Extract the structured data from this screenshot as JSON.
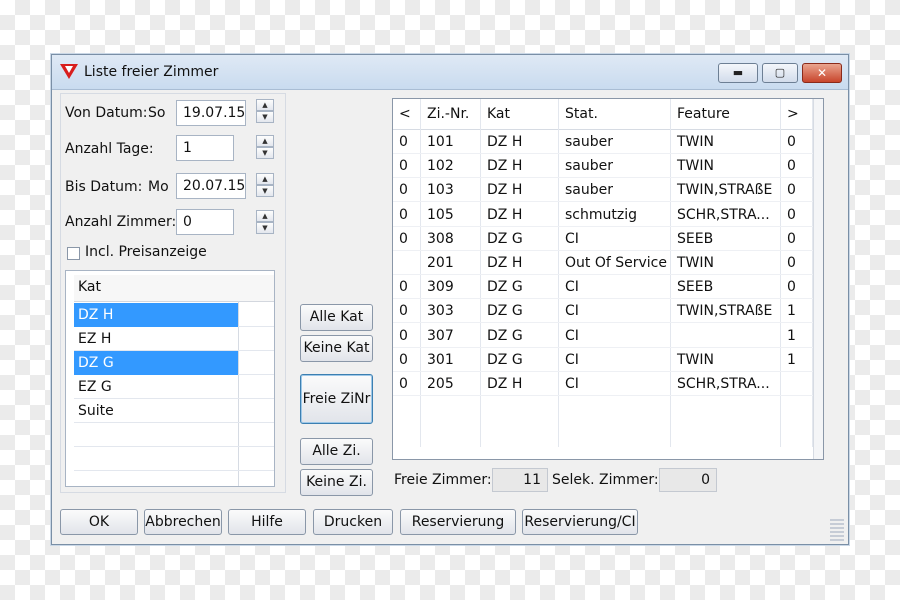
{
  "window": {
    "title": "Liste freier Zimmer",
    "minimize": "▬",
    "maximize": "▢",
    "close": "✕"
  },
  "form": {
    "von_datum_label": "Von Datum:",
    "von_day": "So",
    "von_value": "19.07.15",
    "anzahl_tage_label": "Anzahl Tage:",
    "anzahl_tage_value": "1",
    "bis_datum_label": "Bis Datum:",
    "bis_day": "Mo",
    "bis_value": "20.07.15",
    "anzahl_zimmer_label": "Anzahl Zimmer:",
    "anzahl_zimmer_value": "0",
    "preis_label": "Incl. Preisanzeige"
  },
  "kat_list": {
    "header": "Kat",
    "items": [
      {
        "label": "DZ H",
        "selected": true
      },
      {
        "label": "EZ H",
        "selected": false
      },
      {
        "label": "DZ G",
        "selected": true
      },
      {
        "label": "EZ G",
        "selected": false
      },
      {
        "label": "Suite",
        "selected": false
      }
    ]
  },
  "middle_buttons": {
    "alle_kat": "Alle Kat",
    "keine_kat": "Keine Kat",
    "freie_zinr": "Freie ZiNr",
    "alle_zi": "Alle Zi.",
    "keine_zi": "Keine Zi."
  },
  "grid": {
    "headers": [
      "<",
      "Zi.-Nr.",
      "Kat",
      "Stat.",
      "Feature",
      ">"
    ],
    "rows": [
      [
        "0",
        "101",
        "DZ H",
        "sauber",
        "TWIN",
        "0"
      ],
      [
        "0",
        "102",
        "DZ H",
        "sauber",
        "TWIN",
        "0"
      ],
      [
        "0",
        "103",
        "DZ H",
        "sauber",
        "TWIN,STRAßE",
        "0"
      ],
      [
        "0",
        "105",
        "DZ H",
        "schmutzig",
        "SCHR,STRA...",
        "0"
      ],
      [
        "0",
        "308",
        "DZ G",
        "CI",
        "SEEB",
        "0"
      ],
      [
        "",
        "201",
        "DZ H",
        "Out Of Service",
        "TWIN",
        "0"
      ],
      [
        "0",
        "309",
        "DZ G",
        "CI",
        "SEEB",
        "0"
      ],
      [
        "0",
        "303",
        "DZ G",
        "CI",
        "TWIN,STRAßE",
        "1"
      ],
      [
        "0",
        "307",
        "DZ G",
        "CI",
        "",
        "1"
      ],
      [
        "0",
        "301",
        "DZ G",
        "CI",
        "TWIN",
        "1"
      ],
      [
        "0",
        "205",
        "DZ H",
        "CI",
        "SCHR,STRA...",
        ""
      ]
    ]
  },
  "summary": {
    "freie_label": "Freie Zimmer:",
    "freie_value": "11",
    "selek_label": "Selek. Zimmer:",
    "selek_value": "0"
  },
  "bottom_buttons": {
    "ok": "OK",
    "abbrechen": "Abbrechen",
    "hilfe": "Hilfe",
    "drucken": "Drucken",
    "reservierung": "Reservierung",
    "reservierung_ci": "Reservierung/CI"
  },
  "icons": {
    "app": "red-triangle-icon",
    "spin_up": "▲",
    "spin_down": "▼"
  },
  "colors": {
    "selection": "#3399ff",
    "titlebar": "#c9dbef",
    "window_bg": "#f0f0f0"
  }
}
